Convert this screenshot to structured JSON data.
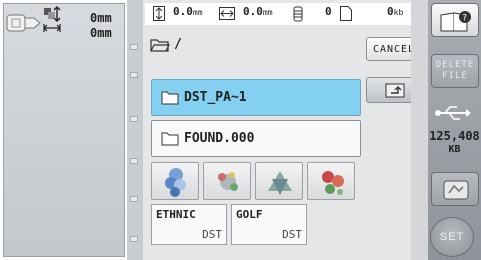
{
  "left": {
    "height_value": "0mm",
    "width_value": "0mm"
  },
  "status": {
    "vert_value": "0.0",
    "vert_unit": "mm",
    "horiz_value": "0.0",
    "horiz_unit": "mm",
    "spool_value": "0",
    "size_value": "0",
    "size_unit": "kb"
  },
  "path": {
    "text": "/"
  },
  "buttons": {
    "cancel": "CANCEL",
    "delete_line1": "DELETE",
    "delete_line2": "FILE",
    "set": "SET"
  },
  "folders": [
    {
      "name": "DST_PA~1",
      "selected": true
    },
    {
      "name": "FOUND.000",
      "selected": false
    }
  ],
  "files": [
    {
      "name": "ETHNIC",
      "type": "DST"
    },
    {
      "name": "GOLF",
      "type": "DST"
    }
  ],
  "capacity": {
    "value": "125,408",
    "unit": "KB"
  },
  "colors": {
    "selected_row": "#84d0f0",
    "panel": "#e4e6e8"
  }
}
